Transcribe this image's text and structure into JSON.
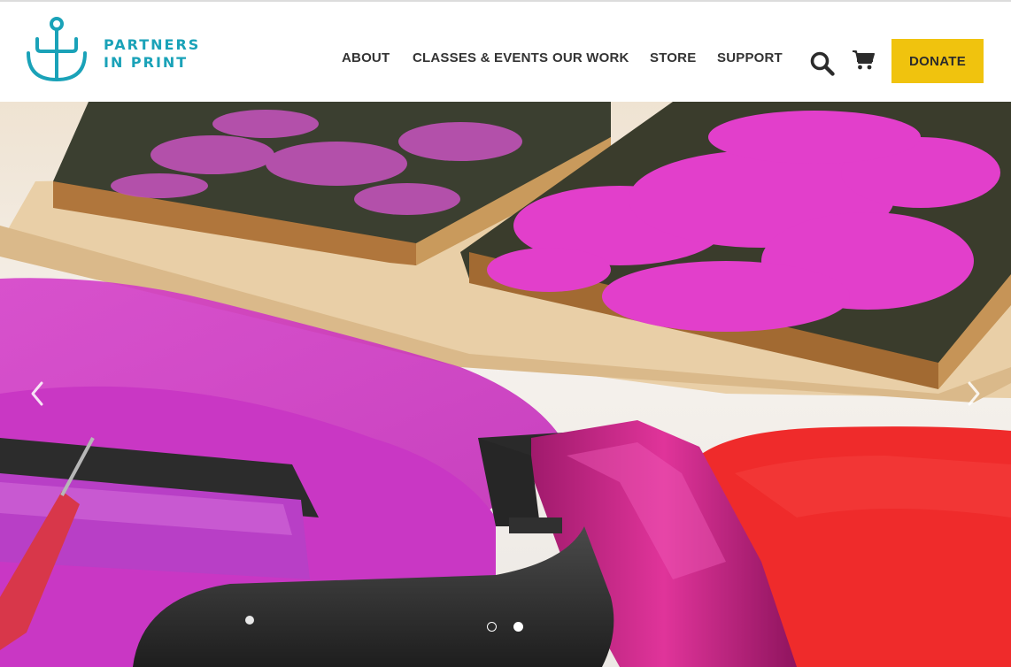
{
  "brand": {
    "name_line1": "PARTNERS",
    "name_line2": "IN PRINT",
    "color": "#1aa2b8",
    "logo_icon": "anchor-icon"
  },
  "nav": {
    "items": [
      {
        "label": "ABOUT"
      },
      {
        "label": "CLASSES & EVENTS"
      },
      {
        "label": "OUR WORK"
      },
      {
        "label": "STORE"
      },
      {
        "label": "SUPPORT"
      }
    ]
  },
  "utility": {
    "search_icon": "search-icon",
    "cart_icon": "cart-icon"
  },
  "donate": {
    "label": "DONATE",
    "color": "#f0c30e"
  },
  "carousel": {
    "prev_icon": "chevron-left-icon",
    "next_icon": "chevron-right-icon",
    "slide_count": 2,
    "active_slide": 2,
    "image_subject": "ink-rollers-and-carved-woodblocks-photo"
  }
}
